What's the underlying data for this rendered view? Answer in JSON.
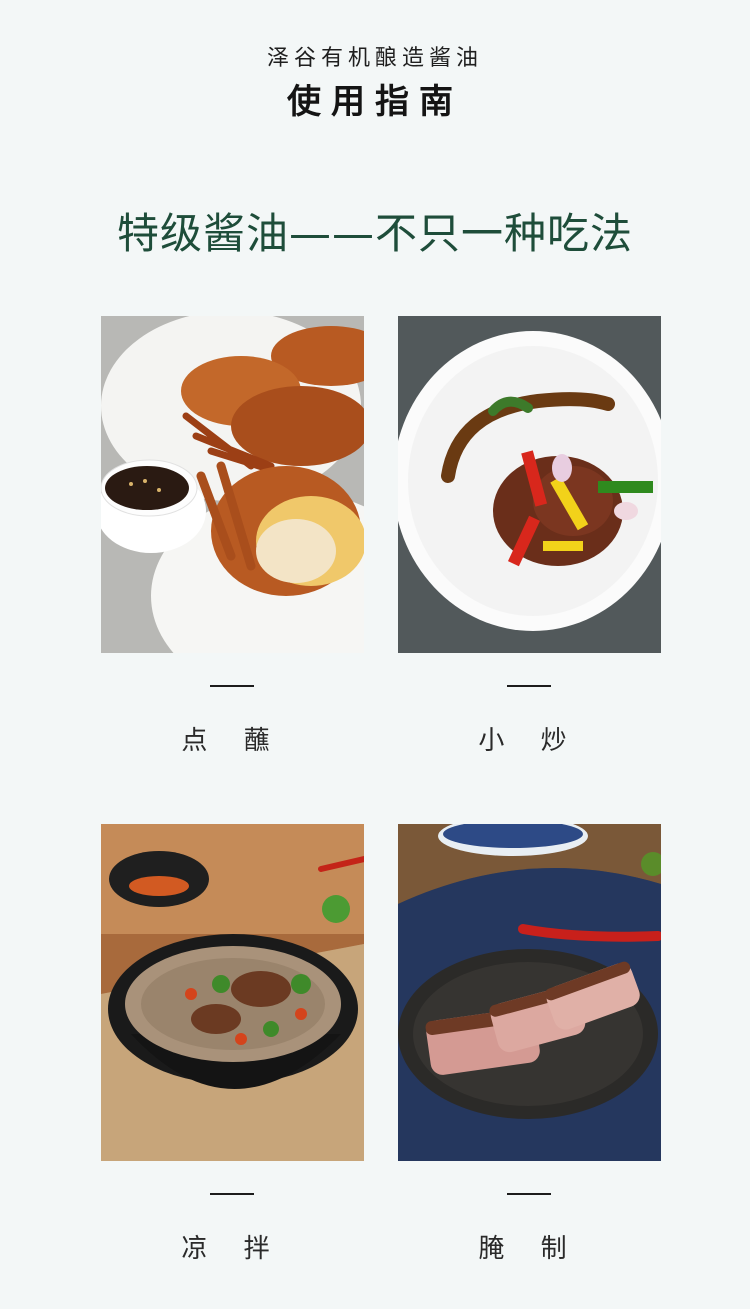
{
  "header": {
    "brand": "泽谷有机酿造酱油",
    "guide": "使用指南"
  },
  "headline": "特级酱油——不只一种吃法",
  "uses": [
    {
      "label": "点 蘸"
    },
    {
      "label": "小 炒"
    },
    {
      "label": "凉 拌"
    },
    {
      "label": "腌 制"
    }
  ]
}
